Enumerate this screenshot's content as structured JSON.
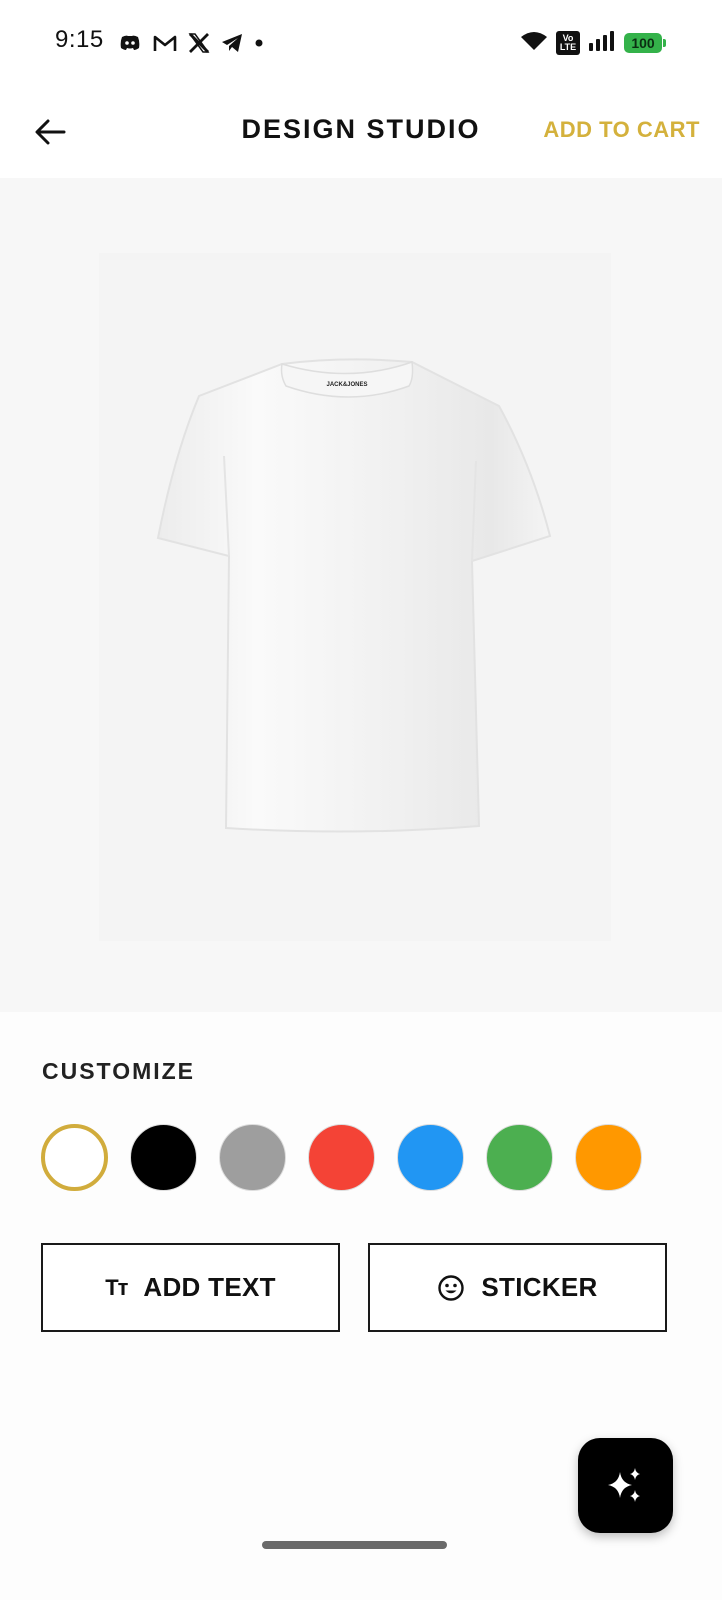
{
  "status_bar": {
    "time": "9:15",
    "notification_icons": [
      "discord-icon",
      "gmail-icon",
      "x-icon",
      "telegram-icon",
      "dot-icon"
    ],
    "volte_top": "Vo",
    "volte_bottom": "LTE",
    "battery": "100"
  },
  "header": {
    "title": "DESIGN STUDIO",
    "add_to_cart_label": "ADD TO CART"
  },
  "canvas": {
    "product_brand": "JACK&JONES",
    "product_color": "#ffffff"
  },
  "customize": {
    "section_label": "CUSTOMIZE",
    "colors": [
      {
        "name": "white",
        "hex": "#ffffff",
        "selected": true
      },
      {
        "name": "black",
        "hex": "#000000",
        "selected": false
      },
      {
        "name": "grey",
        "hex": "#9e9e9e",
        "selected": false
      },
      {
        "name": "red",
        "hex": "#f44336",
        "selected": false
      },
      {
        "name": "blue",
        "hex": "#2196f3",
        "selected": false
      },
      {
        "name": "green",
        "hex": "#4caf50",
        "selected": false
      },
      {
        "name": "orange",
        "hex": "#ff9800",
        "selected": false
      }
    ],
    "accent_color": "#d1ac3c",
    "add_text_icon": "Tт",
    "add_text_label": "ADD TEXT",
    "sticker_label": "STICKER"
  },
  "fab": {
    "icon": "sparkle-icon"
  }
}
